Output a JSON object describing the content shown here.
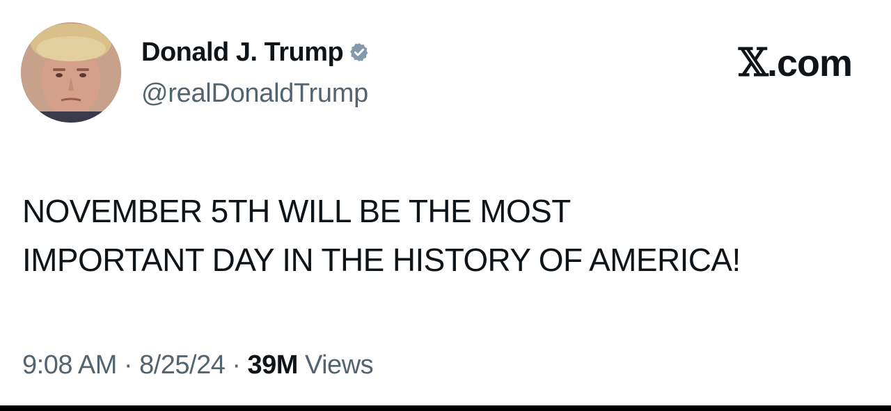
{
  "author": {
    "display_name": "Donald J. Trump",
    "handle": "@realDonaldTrump",
    "verified": true,
    "badge_color": "#829aab"
  },
  "brand": {
    "x_glyph": "𝕏",
    "suffix": ".com"
  },
  "tweet": {
    "lines": [
      "NOVEMBER 5TH WILL BE THE MOST",
      "IMPORTANT DAY IN THE HISTORY OF AMERICA!"
    ]
  },
  "meta": {
    "time": "9:08 AM",
    "separator": "·",
    "date": "8/25/24",
    "views_count": "39M",
    "views_label": "Views"
  },
  "colors": {
    "text_primary": "#0f1419",
    "text_secondary": "#536471",
    "background": "#ffffff"
  }
}
